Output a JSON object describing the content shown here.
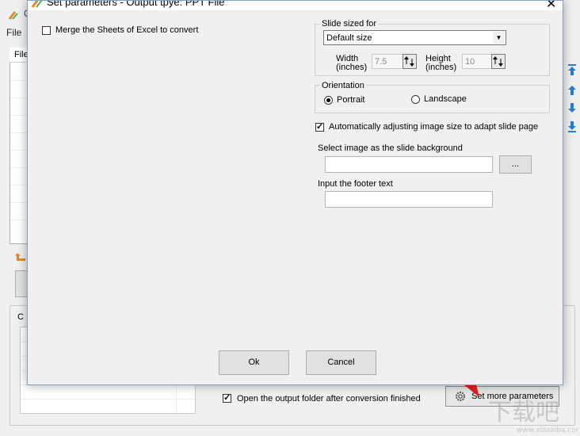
{
  "main": {
    "title_partial": "C",
    "menu_file": "File",
    "list_header": "File",
    "group_label": "C",
    "open_folder_label": "Open the output folder after conversion finished",
    "open_folder_checked": true,
    "set_more_label": "Set more parameters"
  },
  "dialog": {
    "title": "Set parameters - Output tpye: PPT File",
    "close_glyph": "✕",
    "merge_label": "Merge the Sheets of Excel to convert",
    "merge_checked": false,
    "slide_size": {
      "group_title": "Slide sized for",
      "selected": "Default size",
      "width_label_1": "Width",
      "width_label_2": "(inches)",
      "width_value": "7.5",
      "height_label_1": "Height",
      "height_label_2": "(inches)",
      "height_value": "10"
    },
    "orientation": {
      "group_title": "Orientation",
      "portrait_label": "Portrait",
      "landscape_label": "Landscape",
      "selected": "Portrait"
    },
    "auto_adjust_label": "Automatically adjusting image size to adapt slide page",
    "auto_adjust_checked": true,
    "background_label": "Select image as the slide background",
    "background_value": "",
    "browse_label": "...",
    "footer_label": "Input the footer text",
    "footer_value": "",
    "ok_label": "Ok",
    "cancel_label": "Cancel"
  },
  "watermark_text": "下载吧",
  "colors": {
    "accent_blue": "#2b7cd3",
    "annotation_red": "#e02020",
    "orange": "#e8862a"
  }
}
